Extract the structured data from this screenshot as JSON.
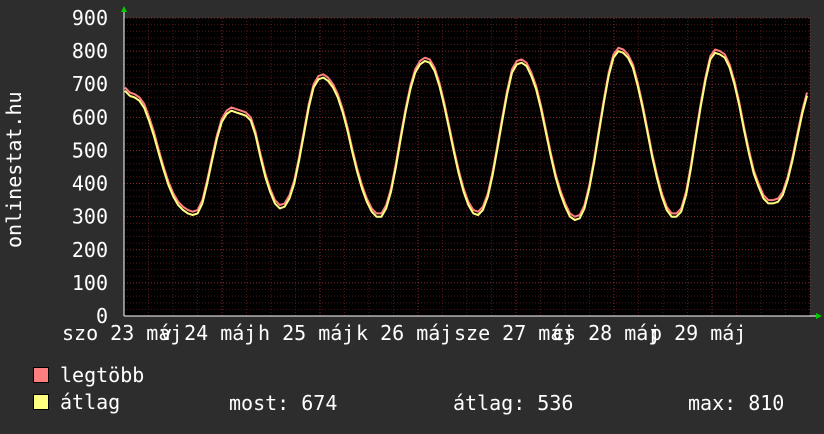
{
  "chart_data": {
    "type": "line",
    "ylabel": "onlinestat.hu",
    "ylim": [
      0,
      900
    ],
    "y_ticks": [
      "0",
      "100",
      "200",
      "300",
      "400",
      "500",
      "600",
      "700",
      "800",
      "900"
    ],
    "x_ticks": [
      "szo 23 máj",
      "v 24 máj",
      "h 25 máj",
      "k 26 máj",
      "sze 27 máj",
      "cs 28 máj",
      "p 29 máj"
    ],
    "grid": true,
    "legend_position": "bottom-left",
    "series": [
      {
        "name": "legtöbb",
        "color": "#ff7f7f",
        "values": [
          690,
          675,
          670,
          660,
          640,
          600,
          555,
          500,
          450,
          405,
          370,
          345,
          330,
          320,
          315,
          320,
          350,
          410,
          480,
          545,
          595,
          620,
          630,
          625,
          620,
          615,
          600,
          555,
          490,
          430,
          385,
          350,
          335,
          340,
          365,
          410,
          480,
          560,
          640,
          700,
          725,
          730,
          720,
          700,
          670,
          625,
          570,
          505,
          445,
          395,
          355,
          325,
          310,
          310,
          335,
          385,
          460,
          545,
          625,
          695,
          745,
          770,
          780,
          775,
          750,
          705,
          645,
          575,
          505,
          440,
          385,
          345,
          320,
          315,
          330,
          370,
          435,
          515,
          600,
          680,
          745,
          770,
          775,
          765,
          735,
          695,
          635,
          565,
          495,
          430,
          380,
          340,
          310,
          300,
          305,
          335,
          395,
          475,
          565,
          655,
          735,
          790,
          810,
          805,
          790,
          760,
          705,
          640,
          565,
          490,
          425,
          370,
          330,
          310,
          310,
          325,
          375,
          455,
          550,
          640,
          720,
          785,
          805,
          800,
          790,
          760,
          710,
          645,
          570,
          500,
          440,
          400,
          365,
          350,
          350,
          355,
          375,
          420,
          480,
          550,
          620,
          675
        ]
      },
      {
        "name": "átlag",
        "color": "#ffff80",
        "values": [
          680,
          665,
          660,
          650,
          628,
          588,
          543,
          490,
          440,
          395,
          360,
          335,
          320,
          310,
          305,
          310,
          340,
          400,
          470,
          535,
          585,
          610,
          620,
          615,
          610,
          605,
          590,
          545,
          480,
          420,
          375,
          340,
          325,
          330,
          355,
          400,
          470,
          550,
          630,
          690,
          715,
          720,
          710,
          690,
          660,
          615,
          560,
          495,
          435,
          385,
          345,
          315,
          300,
          300,
          325,
          375,
          450,
          535,
          615,
          685,
          735,
          760,
          770,
          765,
          740,
          695,
          635,
          565,
          495,
          430,
          375,
          335,
          310,
          305,
          320,
          360,
          425,
          505,
          590,
          670,
          735,
          760,
          765,
          755,
          725,
          685,
          625,
          555,
          485,
          420,
          370,
          330,
          300,
          290,
          295,
          325,
          385,
          465,
          555,
          645,
          725,
          780,
          800,
          795,
          780,
          750,
          695,
          630,
          555,
          480,
          415,
          360,
          320,
          300,
          300,
          315,
          365,
          445,
          540,
          630,
          710,
          775,
          795,
          790,
          780,
          750,
          700,
          635,
          560,
          490,
          430,
          390,
          355,
          340,
          340,
          345,
          365,
          410,
          470,
          540,
          610,
          665
        ]
      }
    ]
  },
  "legend": {
    "item1_label": "legtöbb",
    "item2_label": "átlag"
  },
  "stats": {
    "now_label": "most:",
    "now_value": "674",
    "avg_label": "átlag:",
    "avg_value": "536",
    "max_label": "max:",
    "max_value": "810"
  },
  "colors": {
    "background": "#2d2d2d",
    "plot_background": "#000000",
    "grid": "#8b2a2a",
    "axis": "#ffffff",
    "arrow": "#00cc00"
  }
}
